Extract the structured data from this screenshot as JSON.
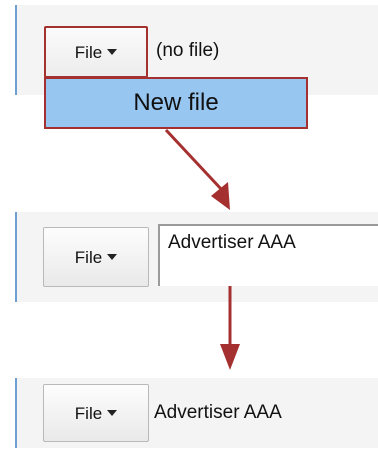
{
  "step1": {
    "file_button_label": "File",
    "status_text": "(no file)"
  },
  "dropdown": {
    "items": [
      {
        "label": "New file"
      }
    ]
  },
  "step2": {
    "file_button_label": "File",
    "name_input_value": "Advertiser AAA"
  },
  "step3": {
    "file_button_label": "File",
    "name_text": "Advertiser AAA"
  },
  "colors": {
    "highlight": "#a53030",
    "menu_bg": "#97c6f1",
    "accent_bar": "#6f9fd0",
    "panel_bg": "#f4f4f4"
  },
  "icons": {
    "dropdown_caret": "caret-down-icon",
    "flow_arrow": "arrow-down-icon"
  }
}
